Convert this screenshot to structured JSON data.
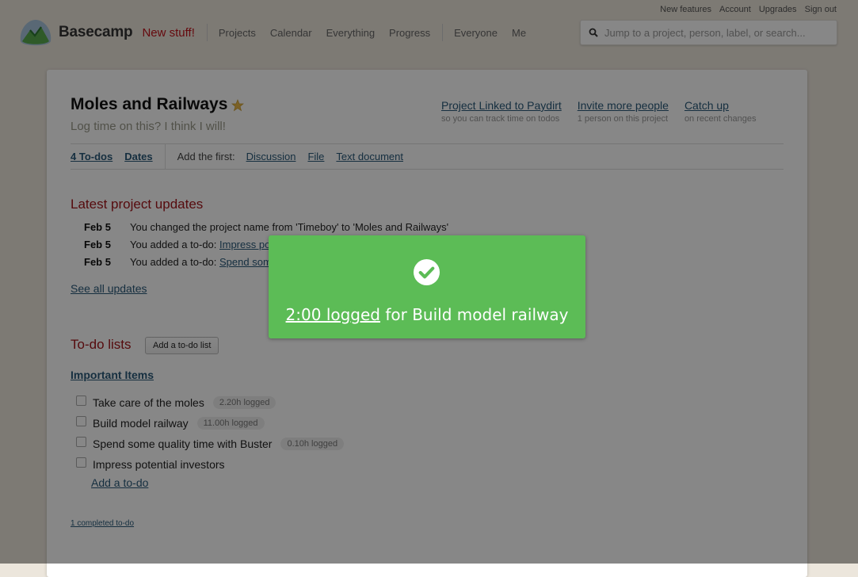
{
  "util_links": [
    "New features",
    "Account",
    "Upgrades",
    "Sign out"
  ],
  "header": {
    "brand": "Basecamp",
    "new_stuff": "New stuff!",
    "nav_primary": [
      "Projects",
      "Calendar",
      "Everything",
      "Progress"
    ],
    "nav_secondary": [
      "Everyone",
      "Me"
    ],
    "search_placeholder": "Jump to a project, person, label, or search..."
  },
  "project": {
    "title": "Moles and Railways",
    "description": "Log time on this? I think I will!",
    "links": [
      {
        "title": "Project Linked to Paydirt",
        "sub": "so you can track time on todos"
      },
      {
        "title": "Invite more people",
        "sub": "1 person on this project"
      },
      {
        "title": "Catch up",
        "sub": "on recent changes"
      }
    ],
    "toolbar": {
      "todos": "4 To-dos",
      "dates": "Dates",
      "add_label": "Add the first:",
      "add_links": [
        "Discussion",
        "File",
        "Text document"
      ]
    }
  },
  "updates": {
    "heading": "Latest project updates",
    "items": [
      {
        "date": "Feb 5",
        "text": "You changed the project name from 'Timeboy' to 'Moles and Railways'",
        "link": ""
      },
      {
        "date": "Feb 5",
        "text": "You added a to-do: ",
        "link": "Impress potential investors"
      },
      {
        "date": "Feb 5",
        "text": "You added a to-do: ",
        "link": "Spend some quality time with Buster"
      }
    ],
    "see_all": "See all updates"
  },
  "todolists": {
    "heading": "To-do lists",
    "add_button": "Add a to-do list",
    "list_name": "Important Items",
    "items": [
      {
        "text": "Take care of the moles",
        "logged": "2.20h logged"
      },
      {
        "text": "Build model railway",
        "logged": "11.00h logged"
      },
      {
        "text": "Spend some quality time with Buster",
        "logged": "0.10h logged"
      },
      {
        "text": "Impress potential investors",
        "logged": ""
      }
    ],
    "add_todo": "Add a to-do",
    "completed": "1 completed to-do"
  },
  "toast": {
    "link": "2:00 logged",
    "text": " for Build model railway",
    "color": "#5cbc56"
  }
}
